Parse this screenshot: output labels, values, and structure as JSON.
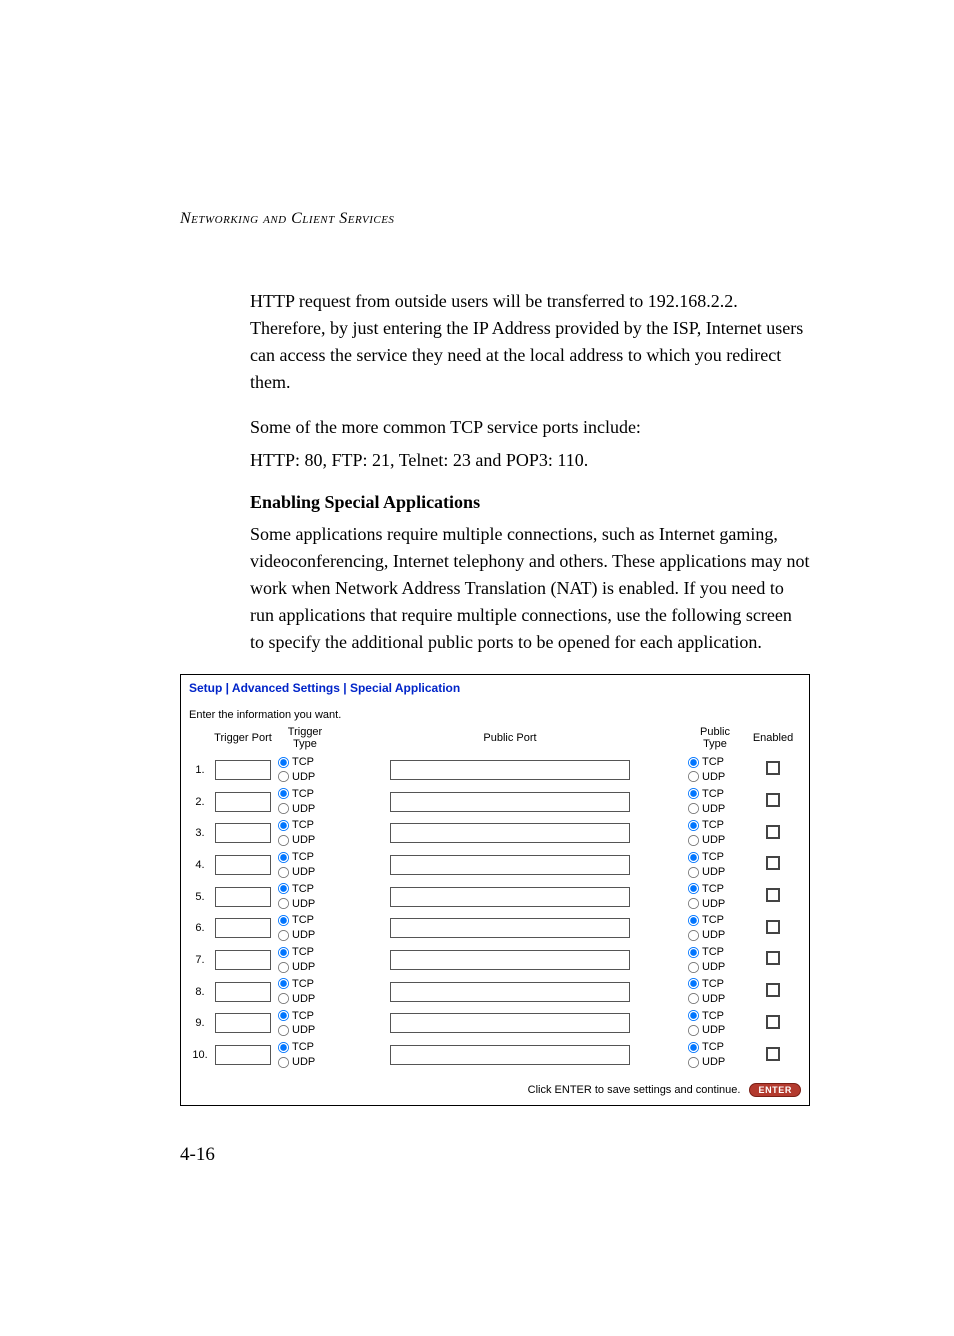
{
  "header": "Networking and Client Services",
  "para1": "HTTP request from outside users will be transferred to 192.168.2.2. Therefore, by just entering the IP Address provided by the ISP, Internet users can access the service they need at the local address to which you redirect them.",
  "para2": "Some of the more common TCP service ports include:",
  "para3": "HTTP: 80, FTP: 21, Telnet: 23 and POP3: 110.",
  "subheading": "Enabling Special Applications",
  "para4": "Some applications require multiple connections, such as Internet gaming, videoconferencing, Internet telephony and others. These applications may not work when Network Address Translation (NAT) is enabled. If you need to run applications that require multiple connections, use the following screen to specify the additional public ports to be opened for each application.",
  "form": {
    "title": "Setup | Advanced Settings | Special Application",
    "note": "Enter the information you want.",
    "cols": {
      "trigger_port": "Trigger Port",
      "trigger_type": "Trigger Type",
      "public_port": "Public Port",
      "public_type": "Public Type",
      "enabled": "Enabled"
    },
    "radio": {
      "tcp": "TCP",
      "udp": "UDP"
    },
    "rows": [
      {
        "n": "1."
      },
      {
        "n": "2."
      },
      {
        "n": "3."
      },
      {
        "n": "4."
      },
      {
        "n": "5."
      },
      {
        "n": "6."
      },
      {
        "n": "7."
      },
      {
        "n": "8."
      },
      {
        "n": "9."
      },
      {
        "n": "10."
      }
    ],
    "enter_note": "Click ENTER to save settings and continue.",
    "enter_label": "ENTER"
  },
  "page_number": "4-16"
}
